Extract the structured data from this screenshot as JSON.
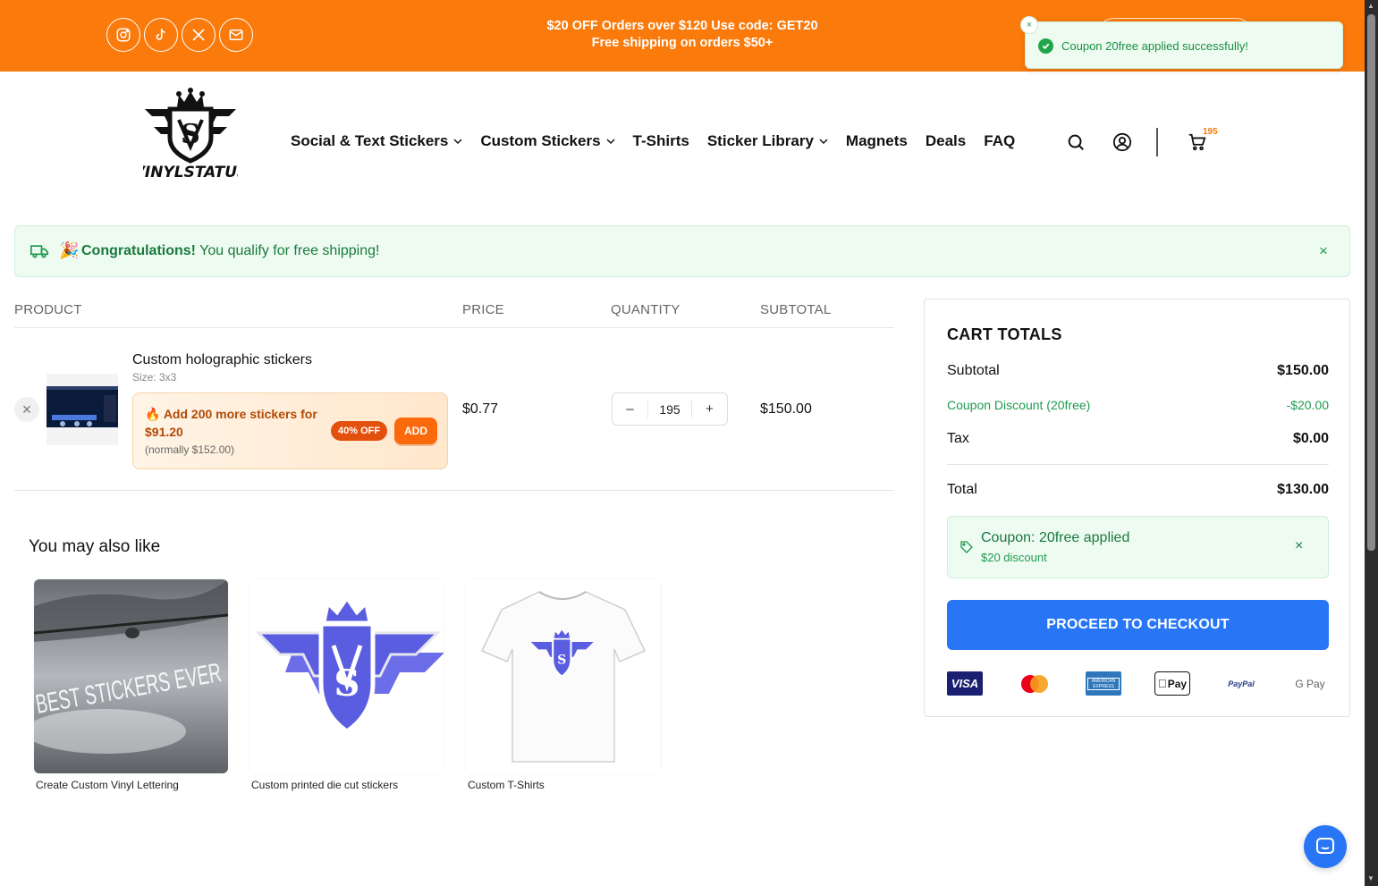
{
  "topbar": {
    "promo_line1": "$20 OFF Orders over $120 Use code: GET20",
    "promo_line2": "Free shipping on orders $50+",
    "social_icons": [
      "instagram-icon",
      "tiktok-icon",
      "x-icon",
      "mail-icon"
    ]
  },
  "toast": {
    "message": "Coupon 20free applied successfully!",
    "close": "×"
  },
  "header": {
    "logo_text": "VINYLSTATUS",
    "nav": [
      {
        "label": "Social & Text Stickers",
        "dropdown": true
      },
      {
        "label": "Custom Stickers",
        "dropdown": true
      },
      {
        "label": "T-Shirts",
        "dropdown": false
      },
      {
        "label": "Sticker Library",
        "dropdown": true
      },
      {
        "label": "Magnets",
        "dropdown": false
      },
      {
        "label": "Deals",
        "dropdown": false
      },
      {
        "label": "FAQ",
        "dropdown": false
      }
    ],
    "cart_count": "195"
  },
  "shipping_banner": {
    "emoji": "🎉",
    "bold": "Congratulations!",
    "text": " You qualify for free shipping!",
    "close": "×"
  },
  "cart": {
    "headers": {
      "product": "PRODUCT",
      "price": "PRICE",
      "quantity": "QUANTITY",
      "subtotal": "SUBTOTAL"
    },
    "item": {
      "name": "Custom holographic stickers",
      "size": "Size: 3x3",
      "price": "$0.77",
      "quantity": "195",
      "subtotal": "$150.00",
      "remove": "×",
      "upsell": {
        "icon": "🔥",
        "title": "Add 200 more stickers for $91.20",
        "note": "(normally $152.00)",
        "badge": "40% OFF",
        "add_label": "ADD"
      },
      "minus": "–",
      "plus": "+"
    }
  },
  "recommendations": {
    "title": "You may also like",
    "items": [
      {
        "label": "Create Custom Vinyl Lettering",
        "image_text": "BEST STICKERS EVER"
      },
      {
        "label": "Custom printed die cut stickers"
      },
      {
        "label": "Custom T-Shirts"
      }
    ]
  },
  "totals": {
    "title": "CART TOTALS",
    "subtotal_label": "Subtotal",
    "subtotal_value": "$150.00",
    "discount_label": "Coupon Discount (20free)",
    "discount_value": "-$20.00",
    "tax_label": "Tax",
    "tax_value": "$0.00",
    "total_label": "Total",
    "total_value": "$130.00",
    "coupon_title": "Coupon: 20free applied",
    "coupon_sub": "$20 discount",
    "coupon_close": "×",
    "checkout_label": "PROCEED TO CHECKOUT",
    "payments": [
      {
        "name": "visa-icon",
        "text": "VISA"
      },
      {
        "name": "mastercard-icon",
        "text": ""
      },
      {
        "name": "amex-icon",
        "text": "AMERICAN EXPRESS"
      },
      {
        "name": "applepay-icon",
        "text": "Pay"
      },
      {
        "name": "paypal-icon",
        "text": "PayPal"
      },
      {
        "name": "googlepay-icon",
        "text": "G Pay"
      }
    ]
  },
  "colors": {
    "accent": "#fa7a0c",
    "checkout_blue": "#2876f5",
    "success_green": "#1f9a4f",
    "success_bg": "#eefbf1"
  }
}
